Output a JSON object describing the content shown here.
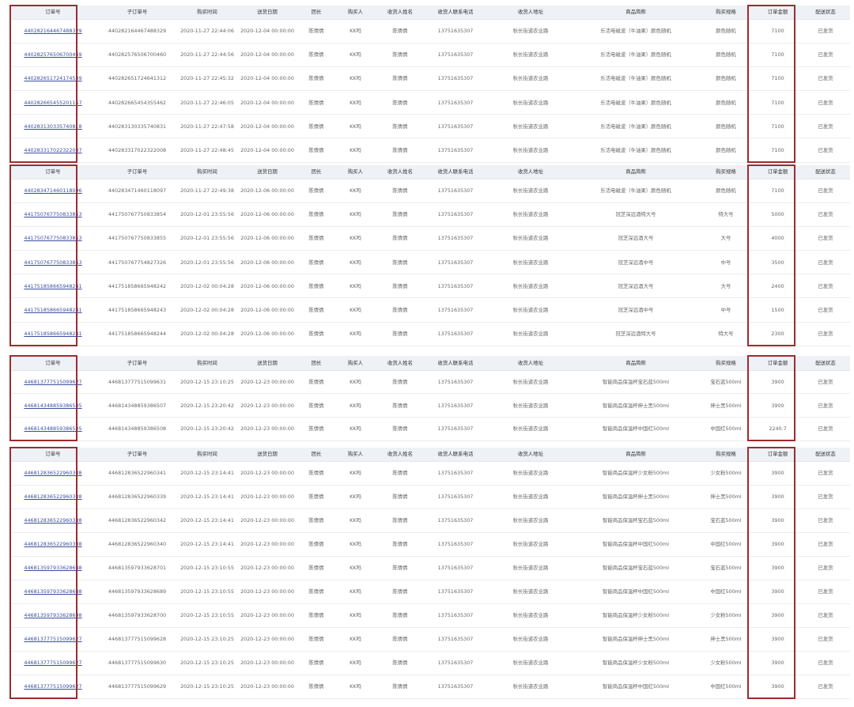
{
  "columns": [
    "订单号",
    "子订单号",
    "购买时间",
    "送货日期",
    "团长",
    "购买人",
    "收货人姓名",
    "收货人联系电话",
    "收货人地址",
    "商品简称",
    "购买规格",
    "订单金额",
    "配送状态"
  ],
  "blocks": [
    {
      "rows": [
        [
          "440282164467488329",
          "440282164467488329",
          "2020-11-27 22:44:06",
          "2020-12-04 00:00:00",
          "陈倩倩",
          "KK吗",
          "陈倩倩",
          "13751635307",
          "秋长街道农业路",
          "乐活电磁波（牛油果）颜色随机",
          "颜色随机",
          "7100",
          "已发货"
        ],
        [
          "440282576506700469",
          "440282576506700460",
          "2020-11-27 22:44:56",
          "2020-12-04 00:00:00",
          "陈倩倩",
          "KK吗",
          "陈倩倩",
          "13751635307",
          "秋长街道农业路",
          "乐活电磁波（牛油果）颜色随机",
          "颜色随机",
          "7100",
          "已发货"
        ],
        [
          "440282651724174539",
          "440282651724641312",
          "2020-11-27 22:45:32",
          "2020-12-04 00:00:00",
          "陈倩倩",
          "KK吗",
          "陈倩倩",
          "13751635307",
          "秋长街道农业路",
          "乐活电磁波（牛油果）颜色随机",
          "颜色随机",
          "7100",
          "已发货"
        ],
        [
          "440282665455201157",
          "440282665454355462",
          "2020-11-27 22:46:05",
          "2020-12-04 00:00:00",
          "陈倩倩",
          "KK吗",
          "陈倩倩",
          "13751635307",
          "秋长街道农业路",
          "乐活电磁波（牛油果）颜色随机",
          "颜色随机",
          "7100",
          "已发货"
        ],
        [
          "440283130335740818",
          "440283130335740831",
          "2020-11-27 22:47:58",
          "2020-12-04 00:00:00",
          "陈倩倩",
          "KK吗",
          "陈倩倩",
          "13751635307",
          "秋长街道农业路",
          "乐活电磁波（牛油果）颜色随机",
          "颜色随机",
          "7100",
          "已发货"
        ],
        [
          "440283317022322007",
          "440283317022322008",
          "2020-11-27 22:48:45",
          "2020-12-04 00:00:00",
          "陈倩倩",
          "KK吗",
          "陈倩倩",
          "13751635307",
          "秋长街道农业路",
          "乐活电磁波（牛油果）颜色随机",
          "颜色随机",
          "7100",
          "已发货"
        ]
      ]
    },
    {
      "rows": [
        [
          "440283471460118096",
          "440283471460118097",
          "2020-11-27 22:49:38",
          "2020-12-06 00:00:00",
          "陈倩倩",
          "KK吗",
          "陈倩倩",
          "13751635307",
          "秋长街道农业路",
          "乐活电磁波（牛油果）颜色随机",
          "颜色随机",
          "7100",
          "已发货"
        ],
        [
          "441750767750833853",
          "441750767750833854",
          "2020-12-01 23:55:56",
          "2020-12-06 00:00:00",
          "陈倩倩",
          "KK吗",
          "陈倩倩",
          "13751635307",
          "秋长街道农业路",
          "冠芝深远酒特大号",
          "特大号",
          "5000",
          "已发货"
        ],
        [
          "441750767750833853",
          "441750767750833855",
          "2020-12-01 23:55:56",
          "2020-12-06 00:00:00",
          "陈倩倩",
          "KK吗",
          "陈倩倩",
          "13751635307",
          "秋长街道农业路",
          "冠芝深远酒大号",
          "大号",
          "4000",
          "已发货"
        ],
        [
          "441750767750833853",
          "441750767754827326",
          "2020-12-01 23:55:56",
          "2020-12-06 00:00:00",
          "陈倩倩",
          "KK吗",
          "陈倩倩",
          "13751635307",
          "秋长街道农业路",
          "冠芝深远酒中号",
          "中号",
          "3500",
          "已发货"
        ],
        [
          "441751858665948241",
          "441751858665948242",
          "2020-12-02 00:04:28",
          "2020-12-06 00:00:00",
          "陈倩倩",
          "KK吗",
          "陈倩倩",
          "13751635307",
          "秋长街道农业路",
          "冠芝深远酒大号",
          "大号",
          "2400",
          "已发货"
        ],
        [
          "441751858665948241",
          "441751858665948243",
          "2020-12-02 00:04:28",
          "2020-12-06 00:00:00",
          "陈倩倩",
          "KK吗",
          "陈倩倩",
          "13751635307",
          "秋长街道农业路",
          "冠芝深远酒中号",
          "中号",
          "1500",
          "已发货"
        ],
        [
          "441751858665948241",
          "441751858665948244",
          "2020-12-02 00:04:28",
          "2020-12-06 00:00:00",
          "陈倩倩",
          "KK吗",
          "陈倩倩",
          "13751635307",
          "秋长街道农业路",
          "冠芝深远酒特大号",
          "特大号",
          "2300",
          "已发货"
        ]
      ]
    },
    {
      "rows": [
        [
          "446813777515099627",
          "446813777515099631",
          "2020-12-15 23:10:25",
          "2020-12-23 00:00:00",
          "陈倩倩",
          "KK吗",
          "陈倩倩",
          "13751635307",
          "秋长街道农业路",
          "智能商品保温杯宝石蓝500ml",
          "宝石蓝500ml",
          "3900",
          "已发货"
        ],
        [
          "446814348859386505",
          "446814348859386507",
          "2020-12-15 23:20:42",
          "2020-12-23 00:00:00",
          "陈倩倩",
          "KK吗",
          "陈倩倩",
          "13751635307",
          "秋长街道农业路",
          "智能商品保温杯绅士黑500ml",
          "绅士黑500ml",
          "3900",
          "已发货"
        ],
        [
          "446814348859386505",
          "446814348859386508",
          "2020-12-15 23:20:42",
          "2020-12-23 00:00:00",
          "陈倩倩",
          "KK吗",
          "陈倩倩",
          "13751635307",
          "秋长街道农业路",
          "智能商品保温杯中国红500ml",
          "中国红500ml",
          "2240.7",
          "已发货"
        ]
      ]
    },
    {
      "rows": [
        [
          "446812836522960338",
          "446812836522960341",
          "2020-12-15 23:14:41",
          "2020-12-23 00:00:00",
          "陈倩倩",
          "KK吗",
          "陈倩倩",
          "13751635307",
          "秋长街道农业路",
          "智能商品保温杯少女粉500ml",
          "少女粉500ml",
          "3900",
          "已发货"
        ],
        [
          "446812836522960338",
          "446812836522960339",
          "2020-12-15 23:14:41",
          "2020-12-23 00:00:00",
          "陈倩倩",
          "KK吗",
          "陈倩倩",
          "13751635307",
          "秋长街道农业路",
          "智能商品保温杯绅士黑500ml",
          "绅士黑500ml",
          "3900",
          "已发货"
        ],
        [
          "446812836522960338",
          "446812836522960342",
          "2020-12-15 23:14:41",
          "2020-12-23 00:00:00",
          "陈倩倩",
          "KK吗",
          "陈倩倩",
          "13751635307",
          "秋长街道农业路",
          "智能商品保温杯宝石蓝500ml",
          "宝石蓝500ml",
          "3900",
          "已发货"
        ],
        [
          "446812836522960338",
          "446812836522960340",
          "2020-12-15 23:14:41",
          "2020-12-23 00:00:00",
          "陈倩倩",
          "KK吗",
          "陈倩倩",
          "13751635307",
          "秋长街道农业路",
          "智能商品保温杯中国红500ml",
          "中国红500ml",
          "3900",
          "已发货"
        ],
        [
          "446813597933628688",
          "446813597933628701",
          "2020-12-15 23:10:55",
          "2020-12-23 00:00:00",
          "陈倩倩",
          "KK吗",
          "陈倩倩",
          "13751635307",
          "秋长街道农业路",
          "智能商品保温杯宝石蓝500ml",
          "宝石蓝500ml",
          "3900",
          "已发货"
        ],
        [
          "446813597933628688",
          "446813597933628689",
          "2020-12-15 23:10:55",
          "2020-12-23 00:00:00",
          "陈倩倩",
          "KK吗",
          "陈倩倩",
          "13751635307",
          "秋长街道农业路",
          "智能商品保温杯中国红500ml",
          "中国红500ml",
          "3900",
          "已发货"
        ],
        [
          "446813597933628688",
          "446813597933628700",
          "2020-12-15 23:10:55",
          "2020-12-23 00:00:00",
          "陈倩倩",
          "KK吗",
          "陈倩倩",
          "13751635307",
          "秋长街道农业路",
          "智能商品保温杯少女粉500ml",
          "少女粉500ml",
          "3900",
          "已发货"
        ],
        [
          "446813777515099627",
          "446813777515099628",
          "2020-12-15 23:10:25",
          "2020-12-23 00:00:00",
          "陈倩倩",
          "KK吗",
          "陈倩倩",
          "13751635307",
          "秋长街道农业路",
          "智能商品保温杯绅士黑500ml",
          "绅士黑500ml",
          "3900",
          "已发货"
        ],
        [
          "446813777515099627",
          "446813777515099630",
          "2020-12-15 23:10:25",
          "2020-12-23 00:00:00",
          "陈倩倩",
          "KK吗",
          "陈倩倩",
          "13751635307",
          "秋长街道农业路",
          "智能商品保温杯少女粉500ml",
          "少女粉500ml",
          "3900",
          "已发货"
        ],
        [
          "446813777515099627",
          "446813777515099629",
          "2020-12-15 23:10:25",
          "2020-12-23 00:00:00",
          "陈倩倩",
          "KK吗",
          "陈倩倩",
          "13751635307",
          "秋长街道农业路",
          "智能商品保温杯中国红500ml",
          "中国红500ml",
          "3900",
          "已发货"
        ]
      ]
    }
  ]
}
